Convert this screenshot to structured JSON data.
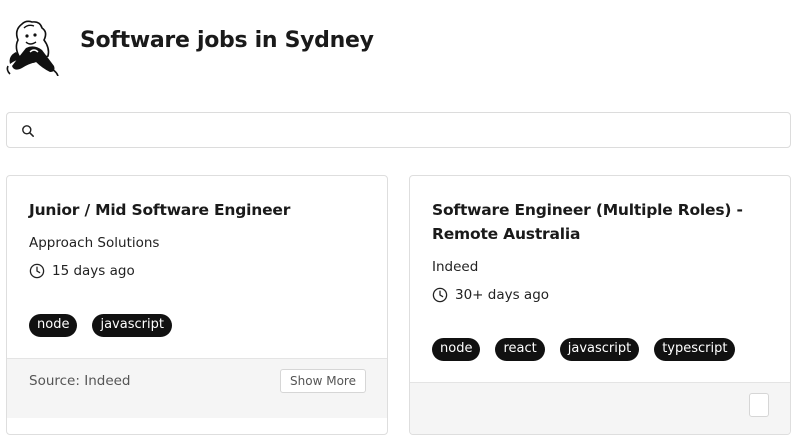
{
  "header": {
    "logo_icon": "cartoon-character-logo",
    "title": "Software jobs in Sydney"
  },
  "search": {
    "icon": "search-icon",
    "value": "",
    "placeholder": ""
  },
  "jobs": [
    {
      "title": "Junior / Mid Software Engineer",
      "company": "Approach Solutions",
      "posted": "15 days ago",
      "tags": [
        "node",
        "javascript"
      ],
      "source": "Source: Indeed",
      "show_more": "Show More"
    },
    {
      "title": "Software Engineer (Multiple Roles) - Remote Australia",
      "company": "Indeed",
      "posted": "30+ days ago",
      "tags": [
        "node",
        "react",
        "javascript",
        "typescript"
      ],
      "source": "",
      "show_more": ""
    }
  ],
  "colors": {
    "tag_bg": "#111111",
    "footer_bg": "#f5f5f5",
    "border": "#dedede"
  }
}
